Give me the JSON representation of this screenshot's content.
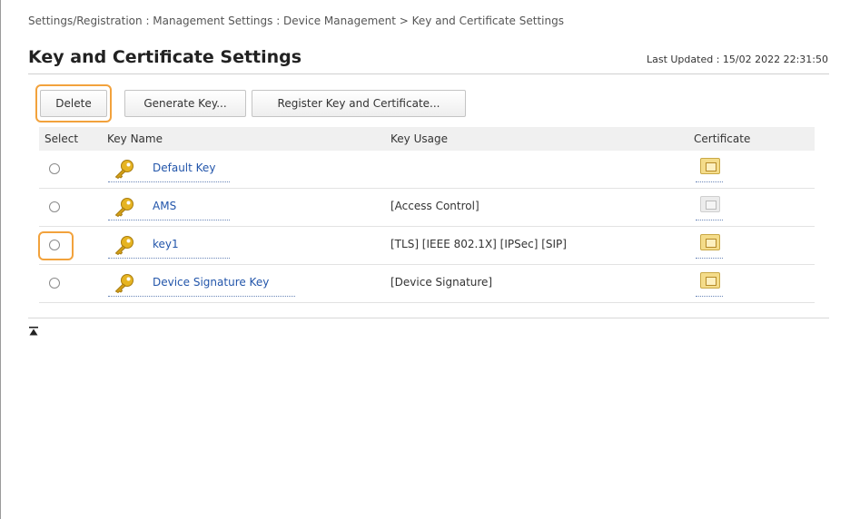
{
  "breadcrumb": "Settings/Registration : Management Settings : Device Management > Key and Certificate Settings",
  "page_title": "Key and Certificate Settings",
  "last_updated": "Last Updated : 15/02 2022 22:31:50",
  "toolbar": {
    "delete_label": "Delete",
    "generate_label": "Generate Key...",
    "register_label": "Register Key and Certificate..."
  },
  "table": {
    "headers": {
      "select": "Select",
      "key_name": "Key Name",
      "key_usage": "Key Usage",
      "certificate": "Certificate"
    },
    "rows": [
      {
        "key_name": "Default Key",
        "key_usage": "",
        "certificate": "active"
      },
      {
        "key_name": "AMS",
        "key_usage": "[Access Control]",
        "certificate": "disabled"
      },
      {
        "key_name": "key1",
        "key_usage": "[TLS] [IEEE 802.1X] [IPSec] [SIP]",
        "certificate": "active"
      },
      {
        "key_name": "Device Signature Key",
        "key_usage": "[Device Signature]",
        "certificate": "active"
      }
    ]
  },
  "icons": {
    "key": "key-icon",
    "certificate": "certificate-icon",
    "to_top": "to-top-icon"
  },
  "colors": {
    "link": "#2255aa",
    "highlight": "#f2a23c",
    "key_gold": "#d4a017"
  }
}
